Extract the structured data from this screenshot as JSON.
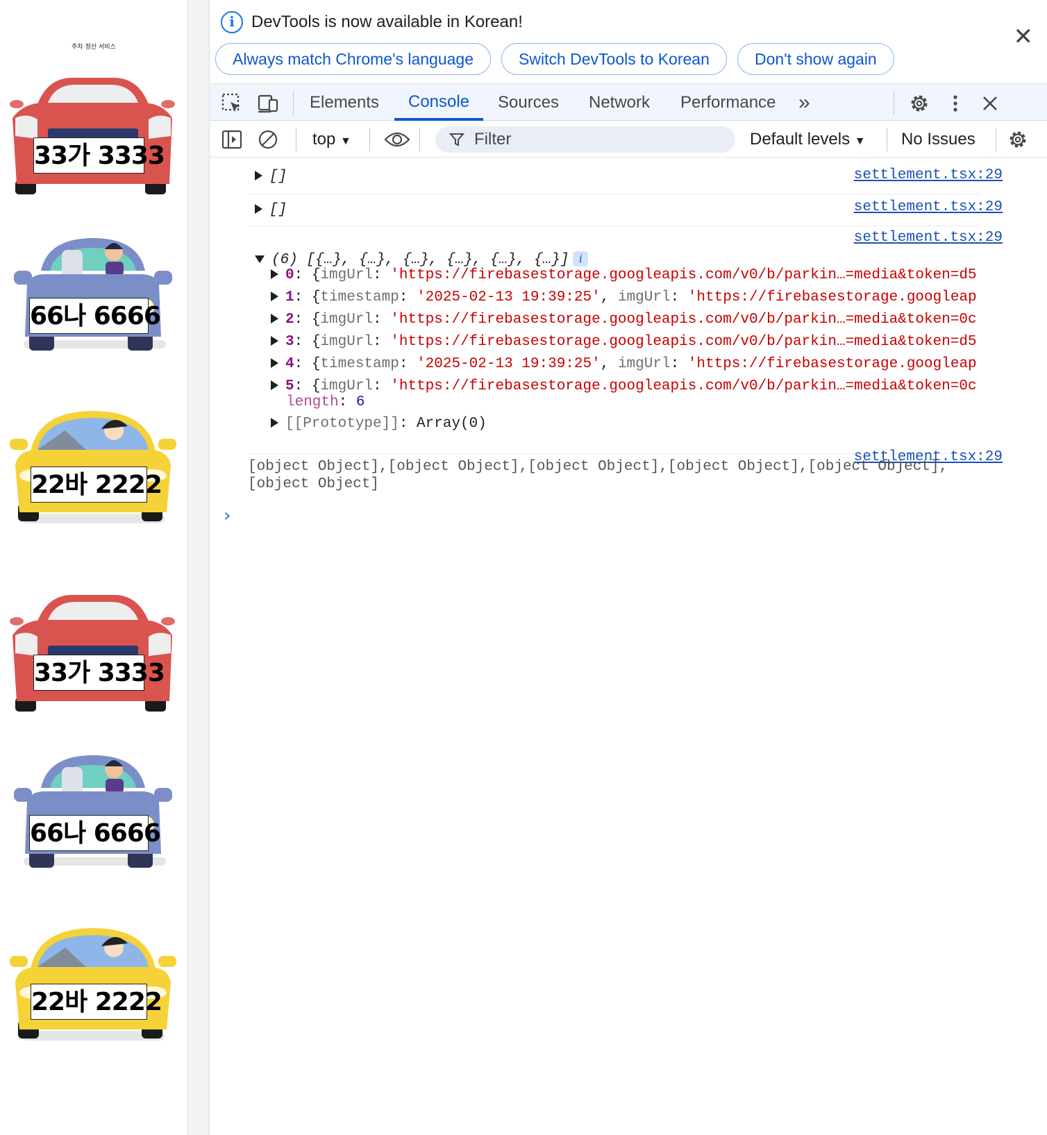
{
  "page": {
    "title": "주차 정산 서비스",
    "cars": [
      {
        "plate": "33가 3333",
        "color": "#d9534f"
      },
      {
        "plate": "66나 6666",
        "color": "#7b8ec8"
      },
      {
        "plate": "22바 2222",
        "color": "#f5d238"
      },
      {
        "plate": "33가 3333",
        "color": "#d9534f"
      },
      {
        "plate": "66나 6666",
        "color": "#7b8ec8"
      },
      {
        "plate": "22바 2222",
        "color": "#f5d238"
      }
    ]
  },
  "infobar": {
    "icon": "info-icon",
    "message": "DevTools is now available in Korean!",
    "buttons": [
      "Always match Chrome's language",
      "Switch DevTools to Korean",
      "Don't show again"
    ],
    "close": "✕"
  },
  "tabs": {
    "items": [
      "Elements",
      "Console",
      "Sources",
      "Network",
      "Performance"
    ],
    "active": "Console",
    "more": "»"
  },
  "toolbar": {
    "context": "top",
    "filter_placeholder": "Filter",
    "levels": "Default levels",
    "issues": "No Issues"
  },
  "console": {
    "source": "settlement.tsx:29",
    "messages": [
      {
        "text": "[]"
      },
      {
        "text": "[]"
      },
      {
        "summary": "(6) [{…}, {…}, {…}, {…}, {…}, {…}]",
        "entries": [
          {
            "index": "0",
            "pairs": [
              [
                "imgUrl",
                "'https://firebasestorage.googleapis.com/v0/b/parkin…=media&token=d5"
              ]
            ]
          },
          {
            "index": "1",
            "pairs": [
              [
                "timestamp",
                "'2025-02-13 19:39:25'"
              ],
              [
                "imgUrl",
                "'https://firebasestorage.googleap"
              ]
            ]
          },
          {
            "index": "2",
            "pairs": [
              [
                "imgUrl",
                "'https://firebasestorage.googleapis.com/v0/b/parkin…=media&token=0c"
              ]
            ]
          },
          {
            "index": "3",
            "pairs": [
              [
                "imgUrl",
                "'https://firebasestorage.googleapis.com/v0/b/parkin…=media&token=d5"
              ]
            ]
          },
          {
            "index": "4",
            "pairs": [
              [
                "timestamp",
                "'2025-02-13 19:39:25'"
              ],
              [
                "imgUrl",
                "'https://firebasestorage.googleap"
              ]
            ]
          },
          {
            "index": "5",
            "pairs": [
              [
                "imgUrl",
                "'https://firebasestorage.googleapis.com/v0/b/parkin…=media&token=0c"
              ]
            ]
          }
        ],
        "length_label": "length",
        "length_value": "6",
        "prototype_label": "[[Prototype]]",
        "prototype_value": "Array(0)"
      },
      {
        "text_line1": "[object Object],[object Object],[object Object],[object Object],[object Object],",
        "text_line2": "[object Object]"
      }
    ],
    "prompt": "›"
  }
}
